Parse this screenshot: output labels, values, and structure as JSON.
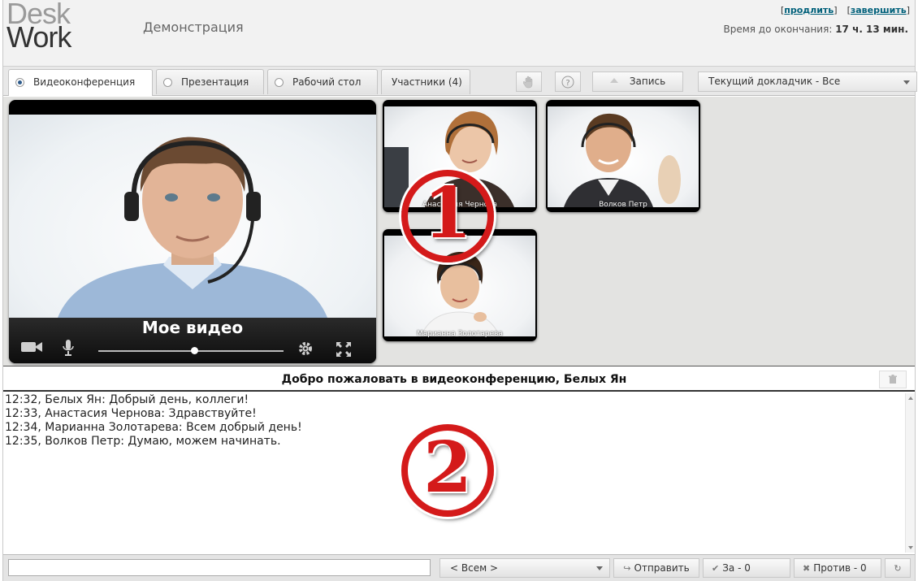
{
  "logo": {
    "line1": "Desk",
    "line2": "Work"
  },
  "header": {
    "title": "Демонстрация",
    "link_prolong": "продлить",
    "link_finish": "завершить",
    "timer_label": "Время до окончания:",
    "timer_value": "17 ч. 13 мин."
  },
  "toolbar": {
    "tabs": [
      {
        "label": "Видеоконференция",
        "active": true
      },
      {
        "label": "Презентация",
        "active": false
      },
      {
        "label": "Рабочий стол",
        "active": false
      },
      {
        "label": "Участники (4)",
        "active": false
      }
    ],
    "hand_icon": "hand-icon",
    "help_icon": "question-icon",
    "record_label": "Запись",
    "speaker_select": "Текущий докладчик - Все"
  },
  "video": {
    "main_caption": "Мое видео",
    "volume_level": 0.5,
    "thumbnails": [
      {
        "name": "Анастасия Чернова"
      },
      {
        "name": "Волков Петр"
      },
      {
        "name": "Марианна Золотарева"
      }
    ],
    "markers": [
      "1",
      "2"
    ]
  },
  "chat": {
    "title": "Добро пожаловать в видеоконференцию, Белых Ян",
    "messages": [
      "12:32, Белых Ян: Добрый день, коллеги!",
      "12:33, Анастасия Чернова: Здравствуйте!",
      "12:34, Марианна Золотарева: Всем добрый день!",
      "12:35, Волков Петр: Думаю, можем начинать."
    ]
  },
  "footer": {
    "input_value": "",
    "recipient_select": "< Всем >",
    "send_label": "Отправить",
    "vote_for_label": "За - 0",
    "vote_against_label": "Против - 0"
  },
  "colors": {
    "accent_link": "#00607a",
    "marker_red": "#d41a1a"
  }
}
